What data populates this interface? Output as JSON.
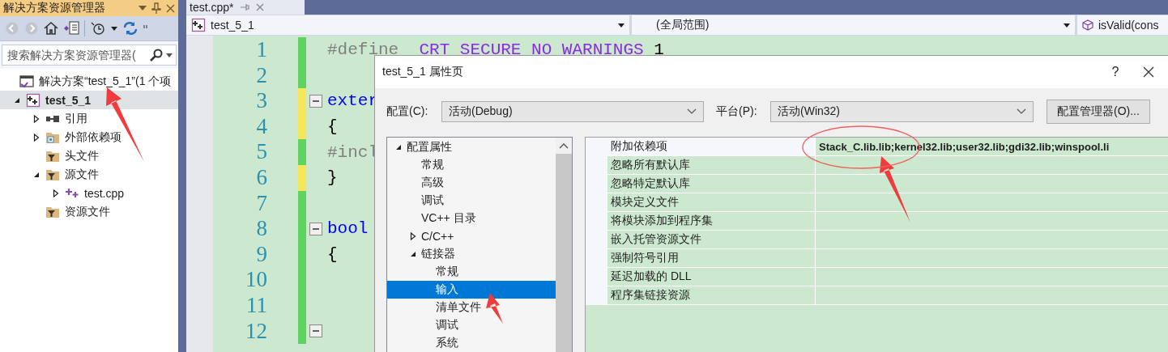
{
  "solution_explorer": {
    "title": "解决方案资源管理器",
    "search": {
      "placeholder": "搜索解决方案资源管理器("
    },
    "tree": [
      {
        "label": "解决方案“test_5_1”(1 个项",
        "kind": "solution",
        "selected": false,
        "children": [
          {
            "label": "test_5_1",
            "kind": "project",
            "selected": true,
            "expanded": true,
            "children": [
              {
                "label": "引用",
                "kind": "references",
                "selected": false,
                "expanded": false
              },
              {
                "label": "外部依赖项",
                "kind": "external",
                "selected": false,
                "expanded": false
              },
              {
                "label": "头文件",
                "kind": "filter",
                "selected": false
              },
              {
                "label": "源文件",
                "kind": "filter",
                "selected": false,
                "expanded": true,
                "children": [
                  {
                    "label": "test.cpp",
                    "kind": "cpp",
                    "selected": false,
                    "expanded": false
                  }
                ]
              },
              {
                "label": "资源文件",
                "kind": "filter",
                "selected": false
              }
            ]
          }
        ]
      }
    ]
  },
  "editor": {
    "tab": {
      "label": "test.cpp*",
      "selected": true
    },
    "navigation": [
      "test_5_1",
      "(全局范围)",
      "isValid(cons"
    ],
    "lines": [
      {
        "number": "1",
        "modified": false,
        "tokens": [
          {
            "text": "#define ",
            "kind": "preprocessor"
          },
          {
            "text": " CRT SECURE NO WARNINGS ",
            "kind": "macro"
          },
          {
            "text": "1",
            "kind": "plain"
          }
        ]
      },
      {
        "number": "2",
        "modified": false
      },
      {
        "number": "3",
        "modified": true,
        "fold": true,
        "tokens": [
          {
            "text": "exter",
            "kind": "keyword"
          }
        ]
      },
      {
        "number": "4",
        "modified": true,
        "tokens": [
          {
            "text": "{",
            "kind": "plain"
          }
        ]
      },
      {
        "number": "5",
        "modified": false,
        "tokens": [
          {
            "text": "#incl",
            "kind": "preprocessor"
          }
        ]
      },
      {
        "number": "6",
        "modified": true,
        "tokens": [
          {
            "text": "}",
            "kind": "plain"
          }
        ]
      },
      {
        "number": "7",
        "modified": false
      },
      {
        "number": "8",
        "modified": false,
        "fold": true,
        "tokens": [
          {
            "text": "bool",
            "kind": "keyword"
          }
        ]
      },
      {
        "number": "9",
        "modified": false,
        "tokens": [
          {
            "text": "{",
            "kind": "plain"
          }
        ]
      },
      {
        "number": "10",
        "modified": false
      },
      {
        "number": "11",
        "modified": false
      },
      {
        "number": "12",
        "modified": false,
        "fold": true
      }
    ]
  },
  "dialog": {
    "title": "test_5_1 属性页",
    "help": "?",
    "configuration": {
      "label": "配置(C):",
      "value": "活动(Debug)"
    },
    "platform": {
      "label": "平台(P):",
      "value": "活动(Win32)"
    },
    "manager_button": "配置管理器(O)...",
    "tree": [
      {
        "label": "配置属性",
        "selected": false,
        "expanded": true,
        "children": [
          {
            "label": "常规",
            "selected": false
          },
          {
            "label": "高级",
            "selected": false
          },
          {
            "label": "调试",
            "selected": false
          },
          {
            "label": "VC++ 目录",
            "selected": false
          },
          {
            "label": "C/C++",
            "selected": false,
            "expanded": false
          },
          {
            "label": "链接器",
            "selected": false,
            "expanded": true,
            "children": [
              {
                "label": "常规",
                "selected": false
              },
              {
                "label": "输入",
                "selected": true
              },
              {
                "label": "清单文件",
                "selected": false
              },
              {
                "label": "调试",
                "selected": false
              },
              {
                "label": "系统",
                "selected": false
              }
            ]
          }
        ]
      }
    ],
    "properties": [
      {
        "name": "附加依赖项",
        "value": "Stack_C.lib.lib;kernel32.lib;user32.lib;gdi32.lib;winspool.li",
        "selected": true
      },
      {
        "name": "忽略所有默认库",
        "selected": false
      },
      {
        "name": "忽略特定默认库",
        "selected": false
      },
      {
        "name": "模块定义文件",
        "selected": false
      },
      {
        "name": "将模块添加到程序集",
        "selected": false
      },
      {
        "name": "嵌入托管资源文件",
        "selected": false
      },
      {
        "name": "强制符号引用",
        "selected": false
      },
      {
        "name": "延迟加载的 DLL",
        "selected": false
      },
      {
        "name": "程序集链接资源",
        "selected": false
      }
    ]
  }
}
